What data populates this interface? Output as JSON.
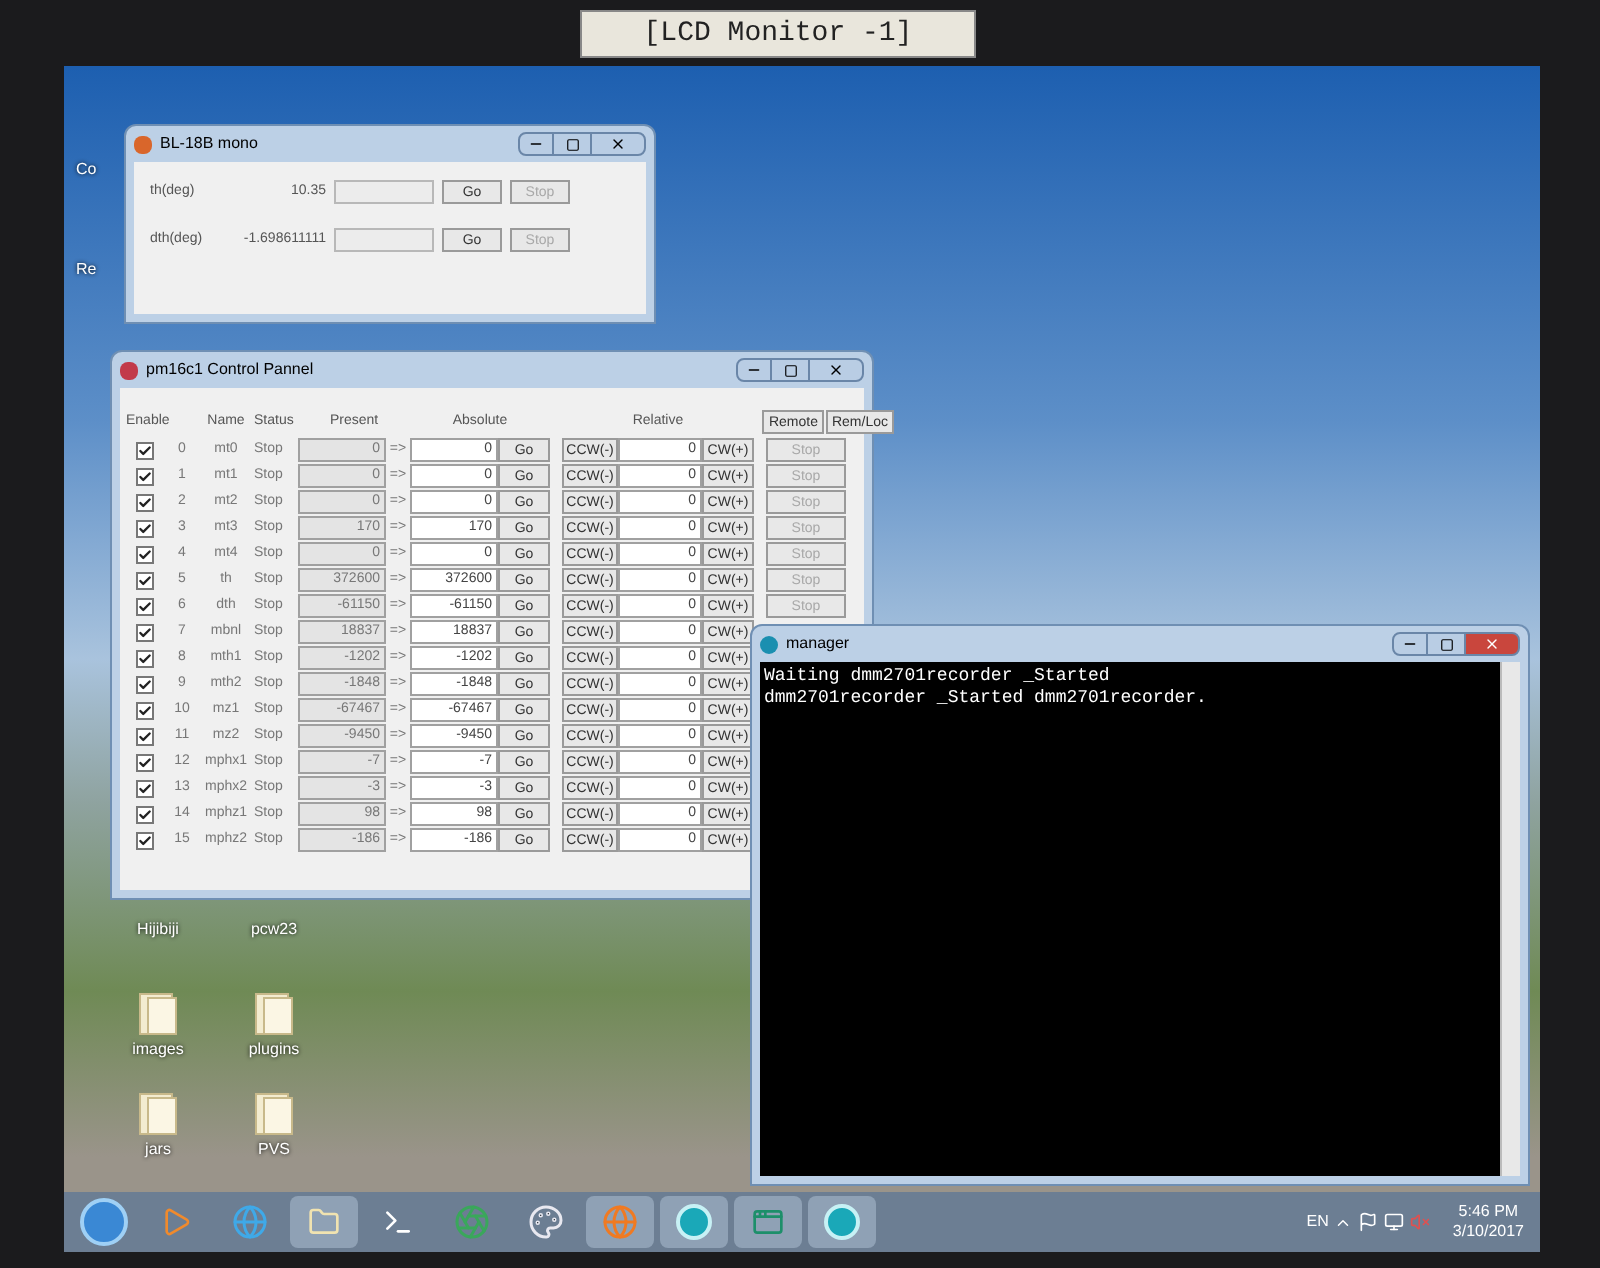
{
  "monitor_label": "[LCD Monitor -1]",
  "desktop_icons": [
    {
      "label": "Co"
    },
    {
      "label": "Re"
    },
    {
      "label": "Hijibiji"
    },
    {
      "label": "pcw23"
    },
    {
      "label": "images"
    },
    {
      "label": "plugins"
    },
    {
      "label": "jars"
    },
    {
      "label": "PVS"
    }
  ],
  "bl_window": {
    "title": "BL-18B mono",
    "rows": [
      {
        "label": "th(deg)",
        "value": "10.35",
        "go": "Go",
        "stop": "Stop",
        "stop_disabled": true
      },
      {
        "label": "dth(deg)",
        "value": "-1.698611111",
        "go": "Go",
        "stop": "Stop",
        "stop_disabled": true
      }
    ]
  },
  "pm_window": {
    "title": "pm16c1 Control Pannel",
    "headers": {
      "enable": "Enable",
      "name": "Name",
      "status": "Status",
      "present": "Present",
      "absolute": "Absolute",
      "relative": "Relative"
    },
    "remote": "Remote",
    "rem_loc": "Rem/Loc",
    "rows": [
      {
        "enabled": true,
        "index": "0",
        "name": "mt0",
        "status": "Stop",
        "present": "0",
        "arrow": "=>",
        "absolute": "0",
        "go": "Go",
        "ccw": "CCW(-)",
        "relative": "0",
        "cw": "CW(+)",
        "stop": "Stop"
      },
      {
        "enabled": true,
        "index": "1",
        "name": "mt1",
        "status": "Stop",
        "present": "0",
        "arrow": "=>",
        "absolute": "0",
        "go": "Go",
        "ccw": "CCW(-)",
        "relative": "0",
        "cw": "CW(+)",
        "stop": "Stop"
      },
      {
        "enabled": true,
        "index": "2",
        "name": "mt2",
        "status": "Stop",
        "present": "0",
        "arrow": "=>",
        "absolute": "0",
        "go": "Go",
        "ccw": "CCW(-)",
        "relative": "0",
        "cw": "CW(+)",
        "stop": "Stop"
      },
      {
        "enabled": true,
        "index": "3",
        "name": "mt3",
        "status": "Stop",
        "present": "170",
        "arrow": "=>",
        "absolute": "170",
        "go": "Go",
        "ccw": "CCW(-)",
        "relative": "0",
        "cw": "CW(+)",
        "stop": "Stop"
      },
      {
        "enabled": true,
        "index": "4",
        "name": "mt4",
        "status": "Stop",
        "present": "0",
        "arrow": "=>",
        "absolute": "0",
        "go": "Go",
        "ccw": "CCW(-)",
        "relative": "0",
        "cw": "CW(+)",
        "stop": "Stop"
      },
      {
        "enabled": true,
        "index": "5",
        "name": "th",
        "status": "Stop",
        "present": "372600",
        "arrow": "=>",
        "absolute": "372600",
        "go": "Go",
        "ccw": "CCW(-)",
        "relative": "0",
        "cw": "CW(+)",
        "stop": "Stop"
      },
      {
        "enabled": true,
        "index": "6",
        "name": "dth",
        "status": "Stop",
        "present": "-61150",
        "arrow": "=>",
        "absolute": "-61150",
        "go": "Go",
        "ccw": "CCW(-)",
        "relative": "0",
        "cw": "CW(+)",
        "stop": "Stop"
      },
      {
        "enabled": true,
        "index": "7",
        "name": "mbnl",
        "status": "Stop",
        "present": "18837",
        "arrow": "=>",
        "absolute": "18837",
        "go": "Go",
        "ccw": "CCW(-)",
        "relative": "0",
        "cw": "CW(+)"
      },
      {
        "enabled": true,
        "index": "8",
        "name": "mth1",
        "status": "Stop",
        "present": "-1202",
        "arrow": "=>",
        "absolute": "-1202",
        "go": "Go",
        "ccw": "CCW(-)",
        "relative": "0",
        "cw": "CW(+)"
      },
      {
        "enabled": true,
        "index": "9",
        "name": "mth2",
        "status": "Stop",
        "present": "-1848",
        "arrow": "=>",
        "absolute": "-1848",
        "go": "Go",
        "ccw": "CCW(-)",
        "relative": "0",
        "cw": "CW(+)"
      },
      {
        "enabled": true,
        "index": "10",
        "name": "mz1",
        "status": "Stop",
        "present": "-67467",
        "arrow": "=>",
        "absolute": "-67467",
        "go": "Go",
        "ccw": "CCW(-)",
        "relative": "0",
        "cw": "CW(+)"
      },
      {
        "enabled": true,
        "index": "11",
        "name": "mz2",
        "status": "Stop",
        "present": "-9450",
        "arrow": "=>",
        "absolute": "-9450",
        "go": "Go",
        "ccw": "CCW(-)",
        "relative": "0",
        "cw": "CW(+)"
      },
      {
        "enabled": true,
        "index": "12",
        "name": "mphx1",
        "status": "Stop",
        "present": "-7",
        "arrow": "=>",
        "absolute": "-7",
        "go": "Go",
        "ccw": "CCW(-)",
        "relative": "0",
        "cw": "CW(+)"
      },
      {
        "enabled": true,
        "index": "13",
        "name": "mphx2",
        "status": "Stop",
        "present": "-3",
        "arrow": "=>",
        "absolute": "-3",
        "go": "Go",
        "ccw": "CCW(-)",
        "relative": "0",
        "cw": "CW(+)"
      },
      {
        "enabled": true,
        "index": "14",
        "name": "mphz1",
        "status": "Stop",
        "present": "98",
        "arrow": "=>",
        "absolute": "98",
        "go": "Go",
        "ccw": "CCW(-)",
        "relative": "0",
        "cw": "CW(+)"
      },
      {
        "enabled": true,
        "index": "15",
        "name": "mphz2",
        "status": "Stop",
        "present": "-186",
        "arrow": "=>",
        "absolute": "-186",
        "go": "Go",
        "ccw": "CCW(-)",
        "relative": "0",
        "cw": "CW(+)"
      }
    ]
  },
  "manager_window": {
    "title": "manager",
    "lines": [
      "Waiting dmm2701recorder _Started",
      "dmm2701recorder _Started dmm2701recorder."
    ]
  },
  "taskbar": {
    "apps": [
      {
        "kind": "start"
      },
      {
        "kind": "media"
      },
      {
        "kind": "ie"
      },
      {
        "kind": "folder"
      },
      {
        "kind": "terminal"
      },
      {
        "kind": "chrome"
      },
      {
        "kind": "paint"
      },
      {
        "kind": "firefox"
      },
      {
        "kind": "app"
      },
      {
        "kind": "window"
      },
      {
        "kind": "app"
      }
    ],
    "language": "EN",
    "time": "5:46 PM",
    "date": "3/10/2017"
  }
}
